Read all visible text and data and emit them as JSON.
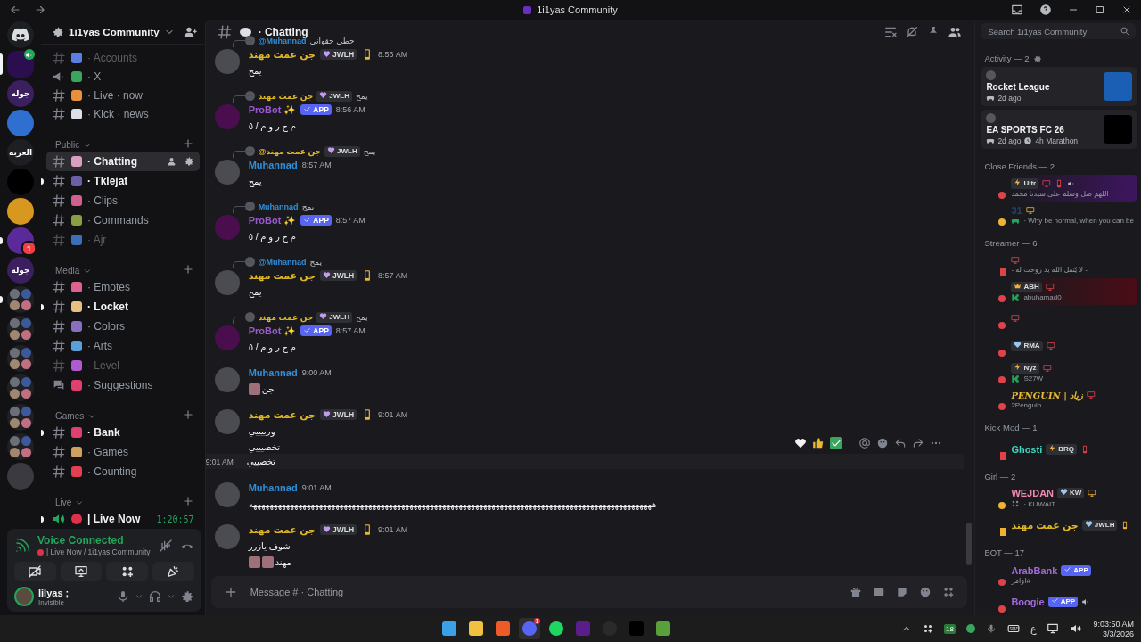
{
  "window": {
    "title": "1i1yas Community"
  },
  "servers": [
    {
      "kind": "home",
      "selected": false,
      "unread": false,
      "voice": false
    },
    {
      "kind": "image",
      "selected": true,
      "unread": false,
      "voice": true
    },
    {
      "kind": "text",
      "label": "جوله",
      "selected": false,
      "unread": false,
      "voice": false
    },
    {
      "kind": "image",
      "selected": false,
      "unread": false,
      "voice": false
    },
    {
      "kind": "text",
      "label": "العزبه",
      "selected": false,
      "unread": false,
      "voice": false
    },
    {
      "kind": "image",
      "selected": false,
      "unread": false,
      "voice": false
    },
    {
      "kind": "image",
      "selected": false,
      "unread": false,
      "voice": false
    },
    {
      "kind": "image",
      "badge": "1",
      "selected": false,
      "unread": true,
      "voice": false
    },
    {
      "kind": "text",
      "label": "جوله",
      "selected": false,
      "unread": false,
      "voice": false
    },
    {
      "kind": "folder",
      "selected": false,
      "unread": true,
      "voice": false
    },
    {
      "kind": "folder",
      "selected": false,
      "unread": false,
      "voice": false
    },
    {
      "kind": "folder",
      "selected": false,
      "unread": false,
      "voice": false
    },
    {
      "kind": "folder",
      "selected": false,
      "unread": false,
      "voice": false
    },
    {
      "kind": "folder",
      "selected": false,
      "unread": false,
      "voice": false
    },
    {
      "kind": "folder",
      "selected": false,
      "unread": false,
      "voice": false
    },
    {
      "kind": "image",
      "selected": false,
      "unread": false,
      "voice": false
    }
  ],
  "sidebar": {
    "server_name": "1i1yas Community",
    "channels": [
      {
        "kind": "text",
        "name": "· Accounts",
        "selected": false,
        "unread": false,
        "muted": true
      },
      {
        "kind": "announcement",
        "name": "· X",
        "selected": false,
        "unread": false,
        "muted": false
      },
      {
        "kind": "text",
        "name": "· Live · now",
        "selected": false,
        "unread": false,
        "muted": false
      },
      {
        "kind": "text",
        "name": "· Kick · news",
        "selected": false,
        "unread": false,
        "muted": false
      }
    ],
    "categories": [
      {
        "name": "Public",
        "channels": [
          {
            "kind": "text",
            "name": "· Chatting",
            "selected": true,
            "unread": false,
            "muted": false
          },
          {
            "kind": "text",
            "name": "· Tklejat",
            "selected": false,
            "unread": true,
            "muted": false
          },
          {
            "kind": "text",
            "name": "· Clips",
            "selected": false,
            "unread": false,
            "muted": false
          },
          {
            "kind": "text",
            "name": "· Commands",
            "selected": false,
            "unread": false,
            "muted": false
          },
          {
            "kind": "text",
            "name": "· Ajr",
            "selected": false,
            "unread": false,
            "muted": true
          }
        ]
      },
      {
        "name": "Media",
        "channels": [
          {
            "kind": "text",
            "name": "· Emotes",
            "selected": false,
            "unread": false,
            "muted": false
          },
          {
            "kind": "text",
            "name": "· Locket",
            "selected": false,
            "unread": true,
            "muted": false
          },
          {
            "kind": "text",
            "name": "· Colors",
            "selected": false,
            "unread": false,
            "muted": false
          },
          {
            "kind": "text",
            "name": "· Arts",
            "selected": false,
            "unread": false,
            "muted": false
          },
          {
            "kind": "text",
            "name": "· Level",
            "selected": false,
            "unread": false,
            "muted": true
          },
          {
            "kind": "forum",
            "name": "· Suggestions",
            "selected": false,
            "unread": false,
            "muted": false
          }
        ]
      },
      {
        "name": "Games",
        "channels": [
          {
            "kind": "text",
            "name": "· Bank",
            "selected": false,
            "unread": true,
            "muted": false
          },
          {
            "kind": "text",
            "name": "· Games",
            "selected": false,
            "unread": false,
            "muted": false
          },
          {
            "kind": "text",
            "name": "· Counting",
            "selected": false,
            "unread": false,
            "muted": false
          }
        ]
      },
      {
        "name": "Live",
        "channels": [
          {
            "kind": "voice",
            "name": "| Live Now",
            "timer": "1:20:57",
            "selected": false,
            "unread": true,
            "muted": false
          }
        ]
      }
    ]
  },
  "voice_panel": {
    "status": "Voice Connected",
    "channel": "| Live Now / 1i1yas Community"
  },
  "user": {
    "name": "lilyas ;",
    "status": "Invisible"
  },
  "chat": {
    "channel": "· Chatting",
    "search_placeholder": "Search 1i1yas Community",
    "input_placeholder": "Message # · Chatting",
    "messages": [
      {
        "kind": "full",
        "hovered": false,
        "reply": {
          "author": "@Muhannad",
          "color": "#2f8fd8",
          "text": "حطي حقواني"
        },
        "author": "جن عمت مهند",
        "color": "#e0b824",
        "tag": {
          "kind": "heart",
          "label": "JWLH"
        },
        "mobile": true,
        "time": "8:56 AM",
        "lines": [
          {
            "text": "يمح"
          }
        ]
      },
      {
        "kind": "full",
        "hovered": false,
        "reply": {
          "author": "جن عمت مهند",
          "color": "#e0b824",
          "tag": "JWLH",
          "text": "يمح"
        },
        "author": "ProBot ✨",
        "color": "#9b59d0",
        "tag": {
          "kind": "app",
          "label": "APP"
        },
        "mobile": false,
        "time": "8:56 AM",
        "lines": [
          {
            "text": "م ح ر و م / ٥"
          }
        ]
      },
      {
        "kind": "full",
        "hovered": false,
        "reply": {
          "author": "@جن عمت مهند",
          "color": "#e0b824",
          "tag": "JWLH",
          "text": "يمح"
        },
        "author": "Muhannad",
        "color": "#2f8fd8",
        "mobile": false,
        "time": "8:57 AM",
        "lines": [
          {
            "text": "يمح"
          }
        ]
      },
      {
        "kind": "full",
        "hovered": false,
        "reply": {
          "author": "Muhannad",
          "color": "#2f8fd8",
          "text": "يمح"
        },
        "author": "ProBot ✨",
        "color": "#9b59d0",
        "tag": {
          "kind": "app",
          "label": "APP"
        },
        "mobile": false,
        "time": "8:57 AM",
        "lines": [
          {
            "text": "م ح ر و م / ٥"
          }
        ]
      },
      {
        "kind": "full",
        "hovered": false,
        "reply": {
          "author": "@Muhannad",
          "color": "#2f8fd8",
          "text": "يمح"
        },
        "author": "جن عمت مهند",
        "color": "#e0b824",
        "tag": {
          "kind": "heart",
          "label": "JWLH"
        },
        "mobile": true,
        "time": "8:57 AM",
        "lines": [
          {
            "text": "يمح"
          }
        ]
      },
      {
        "kind": "full",
        "hovered": false,
        "reply": {
          "author": "جن عمت مهند",
          "color": "#e0b824",
          "tag": "JWLH",
          "text": "يمح"
        },
        "author": "ProBot ✨",
        "color": "#9b59d0",
        "tag": {
          "kind": "app",
          "label": "APP"
        },
        "mobile": false,
        "time": "8:57 AM",
        "lines": [
          {
            "text": "م ح ر و م / ٥"
          }
        ]
      },
      {
        "kind": "full",
        "hovered": false,
        "author": "Muhannad",
        "color": "#2f8fd8",
        "mobile": false,
        "time": "9:00 AM",
        "lines": [
          {
            "text": "جن",
            "emojis": [
              {
                "kind": "custom"
              }
            ]
          }
        ]
      },
      {
        "kind": "full",
        "hovered": false,
        "author": "جن عمت مهند",
        "color": "#e0b824",
        "tag": {
          "kind": "heart",
          "label": "JWLH"
        },
        "mobile": true,
        "time": "9:01 AM",
        "lines": [
          {
            "text": "ورييييي"
          },
          {
            "text": "تخصيييي"
          }
        ]
      },
      {
        "kind": "compact",
        "hovered": true,
        "time": "9:01 AM",
        "lines": [
          {
            "text": "تخصييي"
          }
        ]
      },
      {
        "kind": "full",
        "hovered": false,
        "author": "Muhannad",
        "color": "#2f8fd8",
        "mobile": false,
        "time": "9:01 AM",
        "lines": [
          {
            "text": "ههههههههههههههههههههههههههههههههههههههههههههههههههههههههههههههههههههههههههههههههههههههههههههههههههه"
          }
        ]
      },
      {
        "kind": "full",
        "hovered": false,
        "author": "جن عمت مهند",
        "color": "#e0b824",
        "tag": {
          "kind": "heart",
          "label": "JWLH"
        },
        "mobile": true,
        "time": "9:01 AM",
        "lines": [
          {
            "text": "شوف يازرر"
          },
          {
            "text": "مهند",
            "emojis": [
              {
                "kind": "custom"
              },
              {
                "kind": "custom"
              }
            ]
          }
        ]
      }
    ]
  },
  "members": {
    "activity": {
      "title": "Activity — 2",
      "cards": [
        {
          "game": "Rocket League",
          "meta": [
            "2d ago"
          ]
        },
        {
          "game": "EA SPORTS FC 26",
          "meta": [
            "2d ago",
            "4h Marathon"
          ]
        }
      ]
    },
    "groups": [
      {
        "title": "Close Friends — 2",
        "members": [
          {
            "tag": {
              "kind": "bolt",
              "label": "Ultr"
            },
            "devices": [
              {
                "kind": "desktop"
              },
              {
                "kind": "mobile"
              },
              {
                "kind": "speaker"
              }
            ],
            "status": "اللهم صل وسلم على سيدنا محمد",
            "idle": false,
            "mobile": false,
            "nameplate": {
              "color": "#3e1560"
            }
          },
          {
            "name": "31",
            "color": "#24406e",
            "devices": [
              {
                "kind": "desktop"
              }
            ],
            "status_icon": {
              "kind": "gamepad"
            },
            "status": "· Why be normal, when you can be",
            "idle": true,
            "mobile": false
          }
        ]
      },
      {
        "title": "Streamer — 6",
        "members": [
          {
            "devices": [
              {
                "kind": "desktop"
              }
            ],
            "status": "- لا يُثقل الله بد روحت له -",
            "idle": false,
            "mobile": true
          },
          {
            "tag": {
              "kind": "crown",
              "label": "ABH"
            },
            "devices": [
              {
                "kind": "desktop"
              }
            ],
            "status_icon": {
              "kind": "kick"
            },
            "status": "abuhamad0",
            "idle": false,
            "mobile": false,
            "nameplate": {
              "color": "#4a0c16"
            }
          },
          {
            "devices": [
              {
                "kind": "desktop"
              }
            ],
            "idle": false,
            "mobile": false
          },
          {
            "tag": {
              "kind": "heart",
              "label": "RMA"
            },
            "devices": [
              {
                "kind": "desktop"
              }
            ],
            "idle": false,
            "mobile": false
          },
          {
            "tag": {
              "kind": "bolt",
              "label": "Nyz"
            },
            "devices": [
              {
                "kind": "desktop"
              }
            ],
            "status_icon": {
              "kind": "kick"
            },
            "status": "S27W",
            "idle": false,
            "mobile": false
          },
          {
            "name": "PENGUIN | زياد",
            "color": "#e8b830",
            "devices": [
              {
                "kind": "desktop"
              }
            ],
            "status": "2Penguin",
            "idle": false,
            "mobile": false
          }
        ]
      },
      {
        "title": "Kick Mod — 1",
        "members": [
          {
            "name": "Ghosti",
            "color": "#3fd6c0",
            "tag": {
              "kind": "bolt",
              "label": "BRQ"
            },
            "devices": [
              {
                "kind": "mobile"
              }
            ],
            "idle": false,
            "mobile": true
          }
        ]
      },
      {
        "title": "Girl — 2",
        "members": [
          {
            "name": "WEJDAN",
            "color": "#f08ab0",
            "tag": {
              "kind": "heart",
              "label": "KW"
            },
            "devices": [
              {
                "kind": "desktop"
              }
            ],
            "status_icon": {
              "kind": "grid"
            },
            "status": "· KUWAIT",
            "idle": true,
            "mobile": false
          },
          {
            "name": "جن عمت مهند",
            "color": "#e0b824",
            "tag": {
              "kind": "heart",
              "label": "JWLH"
            },
            "devices": [
              {
                "kind": "mobile"
              }
            ],
            "idle": true,
            "mobile": true
          }
        ]
      },
      {
        "title": "BOT — 17",
        "members": [
          {
            "name": "ArabBank",
            "color": "#a06ad8",
            "tag": {
              "kind": "app",
              "label": "APP"
            },
            "status": "اوامر#",
            "idle": false,
            "mobile": false
          },
          {
            "name": "Boogie",
            "color": "#a06ad8",
            "tag": {
              "kind": "app",
              "label": "APP"
            },
            "devices": [
              {
                "kind": "speaker"
              }
            ],
            "idle": false,
            "mobile": false
          }
        ]
      }
    ]
  },
  "taskbar": {
    "apps": [
      {
        "kind": "windows",
        "active": false
      },
      {
        "kind": "folder",
        "active": false
      },
      {
        "kind": "brave",
        "active": false
      },
      {
        "kind": "discord",
        "badge": "1",
        "active": true
      },
      {
        "kind": "spotify",
        "active": false
      },
      {
        "kind": "nzxt",
        "active": false
      },
      {
        "kind": "obs",
        "active": false
      },
      {
        "kind": "capcut",
        "active": false
      },
      {
        "kind": "minecraft",
        "active": false
      }
    ],
    "tray_badge": "18",
    "language": "ع",
    "time": "9:03:50 AM",
    "date": "3/3/2026"
  }
}
